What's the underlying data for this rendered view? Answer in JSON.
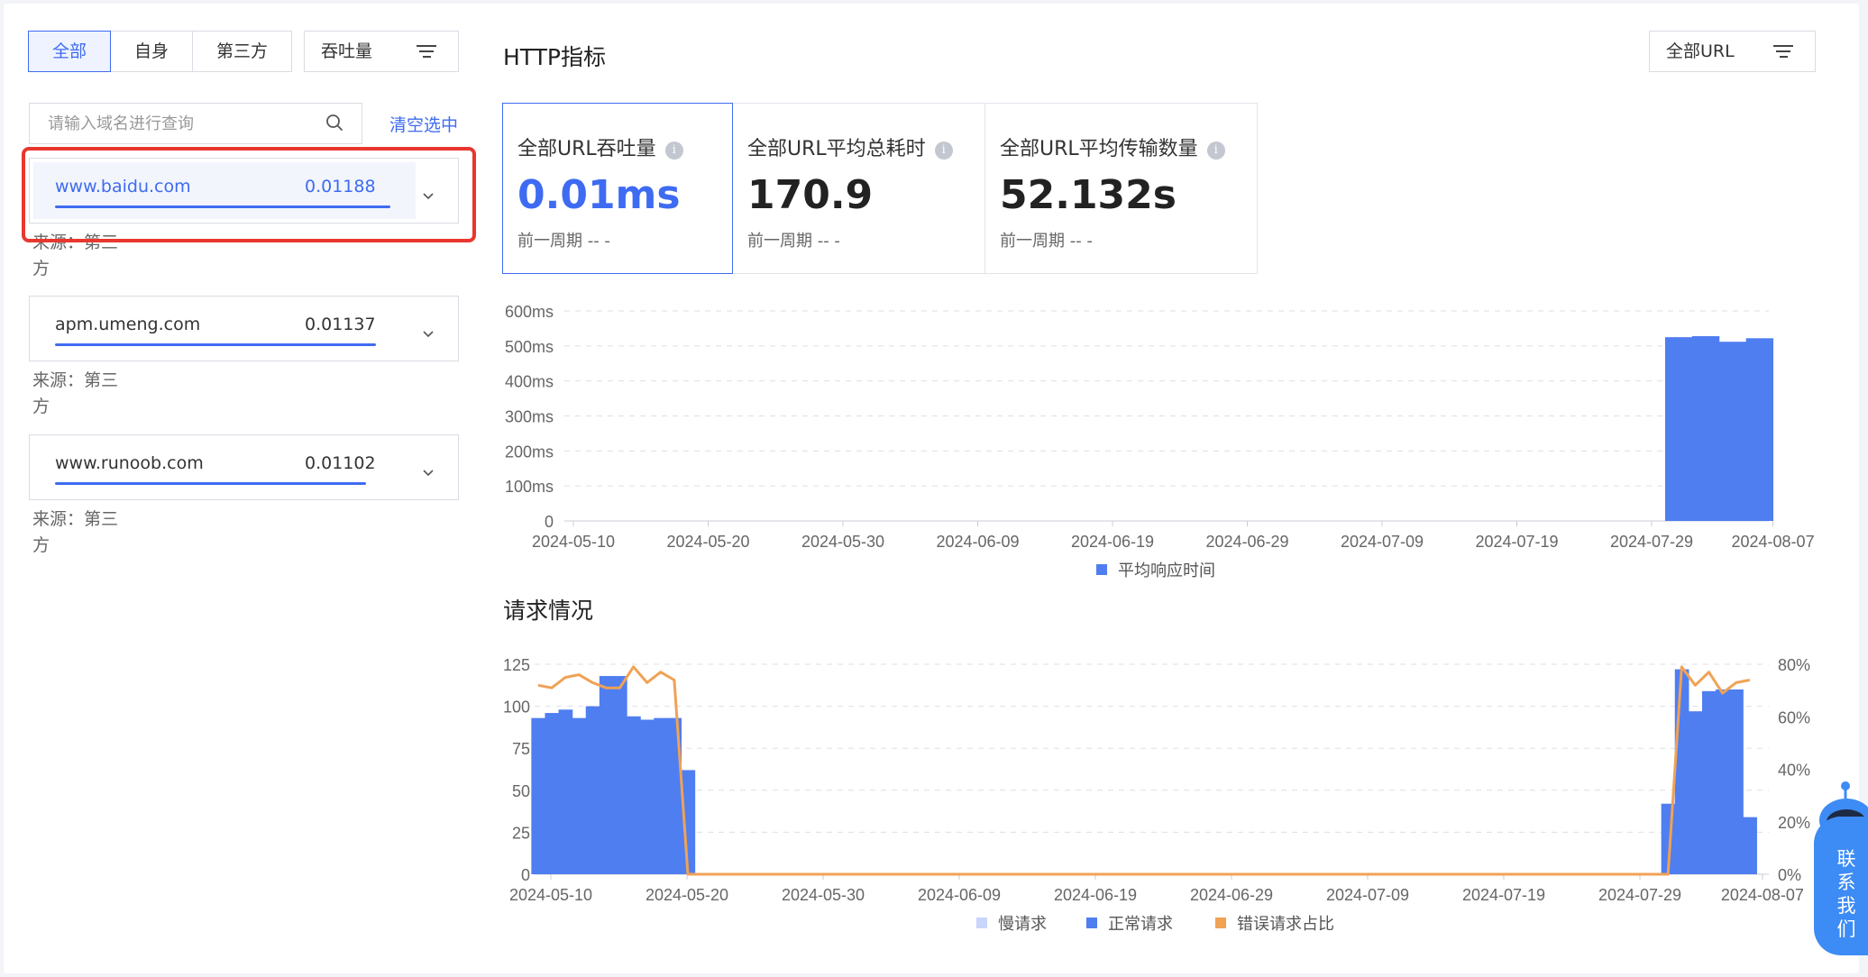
{
  "filter_tabs": [
    {
      "label": "全部",
      "active": true
    },
    {
      "label": "自身",
      "active": false
    },
    {
      "label": "第三方",
      "active": false
    }
  ],
  "sort_select": {
    "value": "吞吐量"
  },
  "search": {
    "placeholder": "请输入域名进行查询",
    "value": ""
  },
  "clear_label": "清空选中",
  "domains": [
    {
      "name": "www.baidu.com",
      "value": "0.01188",
      "bar_fraction": 1.0,
      "source": "来源：第三方",
      "selected": true
    },
    {
      "name": "apm.umeng.com",
      "value": "0.01137",
      "bar_fraction": 0.957,
      "source": "来源：第三方",
      "selected": false
    },
    {
      "name": "www.runoob.com",
      "value": "0.01102",
      "bar_fraction": 0.928,
      "source": "来源：第三方",
      "selected": false
    }
  ],
  "http_title": "HTTP指标",
  "url_select": {
    "value": "全部URL"
  },
  "metrics": [
    {
      "label": "全部URL吞吐量",
      "value": "0.01ms",
      "prev": "前一周期 --    -",
      "active": true
    },
    {
      "label": "全部URL平均总耗时",
      "value": "170.9",
      "prev": "前一周期 --    -",
      "active": false
    },
    {
      "label": "全部URL平均传输数量",
      "value": "52.132s",
      "prev": "前一周期 --    -",
      "active": false
    }
  ],
  "request_title": "请求情况",
  "contact_label": "联系我们",
  "colors": {
    "accent": "#3e6bf2",
    "bar": "#4f7ef0",
    "slow": "#c8d6fa",
    "error": "#f0a255",
    "highlight": "#e8372f"
  },
  "chart_data": [
    {
      "type": "bar",
      "yticks": [
        "0",
        "100ms",
        "200ms",
        "300ms",
        "400ms",
        "500ms",
        "600ms"
      ],
      "ylim": [
        0,
        600
      ],
      "x_ticks": [
        "2024-05-10",
        "2024-05-20",
        "2024-05-30",
        "2024-06-09",
        "2024-06-19",
        "2024-06-29",
        "2024-07-09",
        "2024-07-19",
        "2024-07-29",
        "2024-08-07"
      ],
      "series": [
        {
          "name": "平均响应时间",
          "points": [
            {
              "x": "2024-07-31",
              "y": 525
            },
            {
              "x": "2024-08-02",
              "y": 528
            },
            {
              "x": "2024-08-04",
              "y": 512
            },
            {
              "x": "2024-08-06",
              "y": 522
            }
          ]
        }
      ]
    },
    {
      "type": "bar",
      "y_left_ticks": [
        "0",
        "25",
        "50",
        "75",
        "100",
        "125"
      ],
      "y_left_lim": [
        0,
        125
      ],
      "y_right_ticks": [
        "0%",
        "20%",
        "40%",
        "60%",
        "80%"
      ],
      "y_right_lim": [
        0,
        80
      ],
      "x_ticks": [
        "2024-05-10",
        "2024-05-20",
        "2024-05-30",
        "2024-06-09",
        "2024-06-19",
        "2024-06-29",
        "2024-07-09",
        "2024-07-19",
        "2024-07-29",
        "2024-08-07"
      ],
      "legend": [
        "慢请求",
        "正常请求",
        "错误请求占比"
      ],
      "normal_bars": [
        {
          "x": "2024-05-09",
          "y": 93
        },
        {
          "x": "2024-05-10",
          "y": 96
        },
        {
          "x": "2024-05-11",
          "y": 98
        },
        {
          "x": "2024-05-12",
          "y": 93
        },
        {
          "x": "2024-05-13",
          "y": 100
        },
        {
          "x": "2024-05-14",
          "y": 118
        },
        {
          "x": "2024-05-15",
          "y": 118
        },
        {
          "x": "2024-05-16",
          "y": 94
        },
        {
          "x": "2024-05-17",
          "y": 92
        },
        {
          "x": "2024-05-18",
          "y": 93
        },
        {
          "x": "2024-05-19",
          "y": 93
        },
        {
          "x": "2024-05-20",
          "y": 62
        },
        {
          "x": "2024-07-31",
          "y": 42
        },
        {
          "x": "2024-08-01",
          "y": 122
        },
        {
          "x": "2024-08-02",
          "y": 97
        },
        {
          "x": "2024-08-03",
          "y": 109
        },
        {
          "x": "2024-08-04",
          "y": 110
        },
        {
          "x": "2024-08-05",
          "y": 110
        },
        {
          "x": "2024-08-06",
          "y": 34
        }
      ],
      "error_ratio": [
        {
          "x": "2024-05-09",
          "y": 72
        },
        {
          "x": "2024-05-10",
          "y": 71
        },
        {
          "x": "2024-05-11",
          "y": 75
        },
        {
          "x": "2024-05-12",
          "y": 76
        },
        {
          "x": "2024-05-13",
          "y": 73
        },
        {
          "x": "2024-05-14",
          "y": 71
        },
        {
          "x": "2024-05-15",
          "y": 71
        },
        {
          "x": "2024-05-16",
          "y": 79
        },
        {
          "x": "2024-05-17",
          "y": 73
        },
        {
          "x": "2024-05-18",
          "y": 77
        },
        {
          "x": "2024-05-19",
          "y": 74
        },
        {
          "x": "2024-05-20",
          "y": 0
        },
        {
          "x": "2024-07-31",
          "y": 0
        },
        {
          "x": "2024-08-01",
          "y": 79
        },
        {
          "x": "2024-08-02",
          "y": 72
        },
        {
          "x": "2024-08-03",
          "y": 77
        },
        {
          "x": "2024-08-04",
          "y": 69
        },
        {
          "x": "2024-08-05",
          "y": 73
        },
        {
          "x": "2024-08-06",
          "y": 74
        }
      ]
    }
  ]
}
